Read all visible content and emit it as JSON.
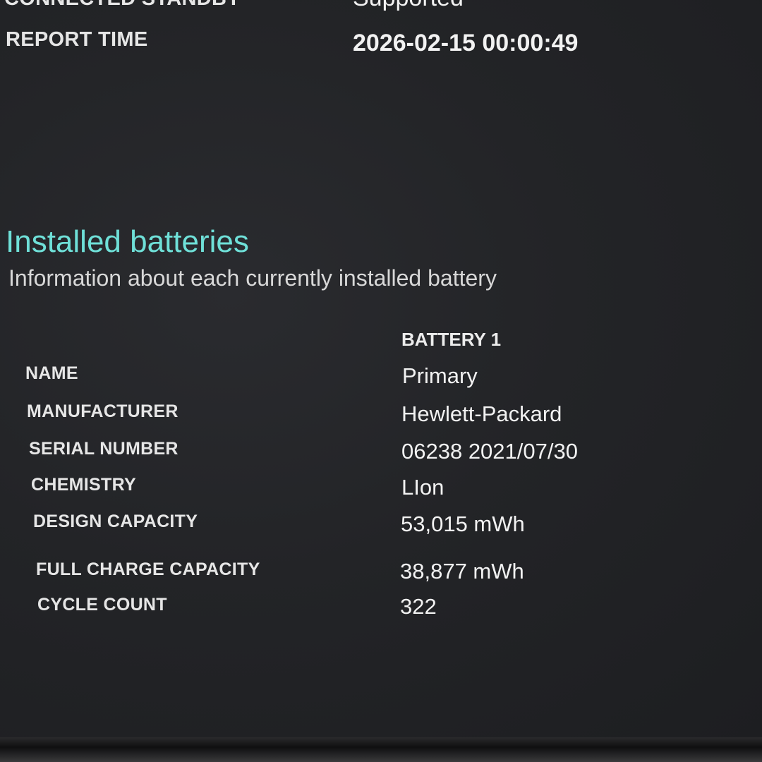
{
  "header_rows": [
    {
      "label": "CONNECTED STANDBY",
      "value": "Supported"
    },
    {
      "label": "REPORT TIME",
      "value": "2026-02-15  00:00:49"
    }
  ],
  "section": {
    "title": "Installed batteries",
    "subtitle": "Information about each currently installed battery"
  },
  "battery_table": {
    "column_header": "BATTERY 1",
    "rows": [
      {
        "label": "NAME",
        "value": "Primary"
      },
      {
        "label": "MANUFACTURER",
        "value": "Hewlett-Packard"
      },
      {
        "label": "SERIAL NUMBER",
        "value": "06238 2021/07/30"
      },
      {
        "label": "CHEMISTRY",
        "value": "LIon"
      },
      {
        "label": "DESIGN CAPACITY",
        "value": "53,015 mWh"
      },
      {
        "label": "FULL CHARGE CAPACITY",
        "value": "38,877 mWh"
      },
      {
        "label": "CYCLE COUNT",
        "value": "322"
      }
    ]
  },
  "colors": {
    "background": "#232427",
    "section_title": "#6fe0d8",
    "text": "#ececec"
  }
}
